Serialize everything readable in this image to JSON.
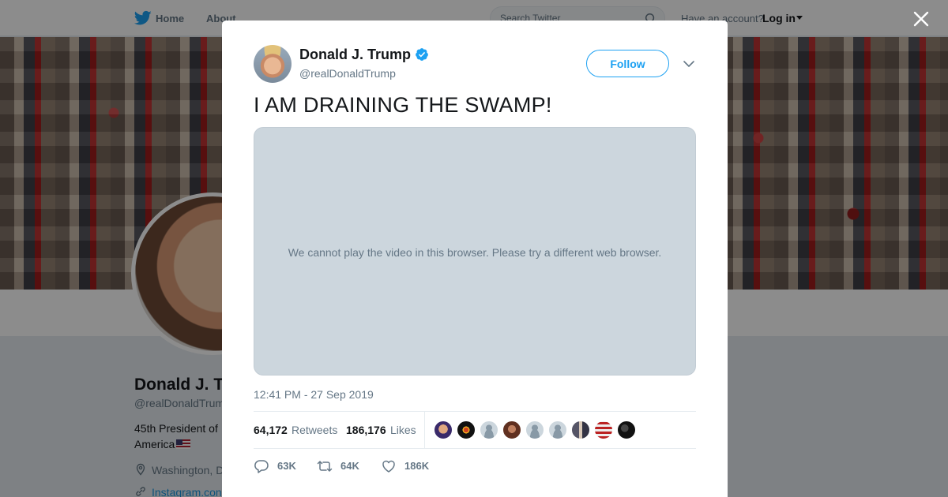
{
  "nav": {
    "home_label": "Home",
    "about_label": "About",
    "search_placeholder": "Search Twitter",
    "have_account_text": "Have an account?",
    "login_label": "Log in"
  },
  "profile": {
    "name": "Donald J. T",
    "handle": "@realDonaldTrum",
    "bio_line1": "45th President of",
    "bio_line2": "America",
    "location": "Washington, D",
    "link": "Instagram.con"
  },
  "tweet": {
    "author_name": "Donald J. Trump",
    "author_handle": "@realDonaldTrump",
    "follow_label": "Follow",
    "text": "I AM DRAINING THE SWAMP!",
    "video_message": "We cannot play the video in this browser. Please try a different web browser.",
    "timestamp": "12:41 PM - 27 Sep 2019",
    "stats": {
      "retweets_count": "64,172",
      "retweets_label": "Retweets",
      "likes_count": "186,176",
      "likes_label": "Likes"
    },
    "actions": {
      "replies": "63K",
      "retweets": "64K",
      "likes": "186K"
    }
  },
  "icons": {
    "twitter": "twitter-bird-icon",
    "search": "search-icon",
    "close": "close-icon",
    "verified": "verified-badge-icon",
    "caret": "chevron-down-icon",
    "reply": "reply-icon",
    "retweet": "retweet-icon",
    "like": "heart-icon",
    "location": "location-pin-icon",
    "link": "link-icon"
  },
  "colors": {
    "brand_blue": "#1da1f2",
    "secondary_text": "#657786",
    "video_placeholder": "#ccd6dd"
  }
}
